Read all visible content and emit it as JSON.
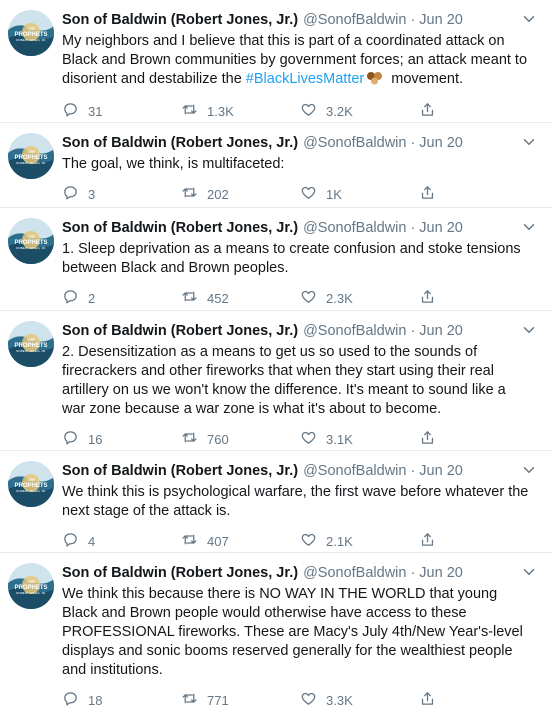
{
  "account": {
    "name": "Son of Baldwin (Robert Jones, Jr.)",
    "handle": "@SonofBaldwin",
    "avatar_text": "THE PROPHETS",
    "avatar_subtext": "ROBERT JONES, JR."
  },
  "separator": "·",
  "colors": {
    "accent": "#1da1f2",
    "muted": "#657786",
    "divider": "#e6ecf0"
  },
  "icons": {
    "reply": "reply-icon",
    "retweet": "retweet-icon",
    "like": "heart-icon",
    "share": "share-icon",
    "more": "chevron-down-icon"
  },
  "tweets": [
    {
      "date": "Jun 20",
      "text_before": "My neighbors and I believe that this is part of a coordinated attack on Black and Brown communities by government forces; an attack meant to disorient and destabilize the ",
      "hashtag": "#BlackLivesMatter",
      "text_after": " movement.",
      "replies": "31",
      "retweets": "1.3K",
      "likes": "3.2K"
    },
    {
      "date": "Jun 20",
      "text": "The goal, we think, is multifaceted:",
      "replies": "3",
      "retweets": "202",
      "likes": "1K"
    },
    {
      "date": "Jun 20",
      "text": "1. Sleep deprivation as a means to create confusion and stoke tensions between Black and Brown peoples.",
      "replies": "2",
      "retweets": "452",
      "likes": "2.3K"
    },
    {
      "date": "Jun 20",
      "text": "2. Desensitization as a means to get us so used to the sounds of firecrackers and other fireworks that when they start using their real artillery on us we won't know the difference. It's meant to sound like a war zone because a war zone is what it's about to become.",
      "replies": "16",
      "retweets": "760",
      "likes": "3.1K"
    },
    {
      "date": "Jun 20",
      "text": "We think this is psychological warfare, the first wave before whatever the next stage of the attack is.",
      "replies": "4",
      "retweets": "407",
      "likes": "2.1K"
    },
    {
      "date": "Jun 20",
      "text": "We think this because there is NO WAY IN THE WORLD that young Black and Brown people would otherwise have access to these PROFESSIONAL fireworks. These are Macy's July 4th/New Year's-level displays and sonic booms reserved generally for the wealthiest people and institutions.",
      "replies": "18",
      "retweets": "771",
      "likes": "3.3K"
    }
  ]
}
